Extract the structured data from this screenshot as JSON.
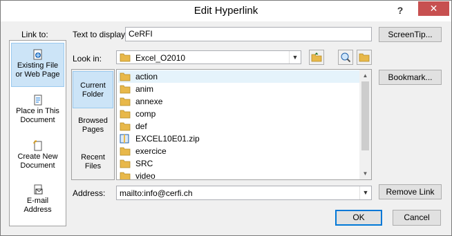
{
  "window": {
    "title": "Edit Hyperlink",
    "help": "?",
    "close": "✕"
  },
  "link_to": {
    "label": "Link to:",
    "items": [
      {
        "l1": "Existing File",
        "l2": "or Web Page",
        "icon": "web-page-icon",
        "selected": true
      },
      {
        "l1": "Place in This",
        "l2": "Document",
        "icon": "document-place-icon",
        "selected": false
      },
      {
        "l1": "Create New",
        "l2": "Document",
        "icon": "new-document-icon",
        "selected": false
      },
      {
        "l1": "E-mail",
        "l2": "Address",
        "icon": "email-icon",
        "selected": false
      }
    ]
  },
  "text_to_display": {
    "label": "Text to display:",
    "value": "CeRFI"
  },
  "screentip": "ScreenTip...",
  "look_in": {
    "label": "Look in:",
    "value": "Excel_O2010"
  },
  "sidebar": {
    "items": [
      {
        "l1": "Current",
        "l2": "Folder",
        "selected": true
      },
      {
        "l1": "Browsed",
        "l2": "Pages",
        "selected": false
      },
      {
        "l1": "Recent",
        "l2": "Files",
        "selected": false
      }
    ]
  },
  "files": [
    {
      "name": "action",
      "type": "folder",
      "selected": true
    },
    {
      "name": "anim",
      "type": "folder",
      "selected": false
    },
    {
      "name": "annexe",
      "type": "folder",
      "selected": false
    },
    {
      "name": "comp",
      "type": "folder",
      "selected": false
    },
    {
      "name": "def",
      "type": "folder",
      "selected": false
    },
    {
      "name": "EXCEL10E01.zip",
      "type": "zip",
      "selected": false
    },
    {
      "name": "exercice",
      "type": "folder",
      "selected": false
    },
    {
      "name": "SRC",
      "type": "folder",
      "selected": false
    },
    {
      "name": "video",
      "type": "folder",
      "selected": false
    }
  ],
  "bookmark": "Bookmark...",
  "address": {
    "label": "Address:",
    "value": "mailto:info@cerfi.ch"
  },
  "remove_link": "Remove Link",
  "ok": "OK",
  "cancel": "Cancel",
  "colors": {
    "accent": "#0078d7",
    "selection": "#cce4f7",
    "folder": "#e8b84a",
    "close": "#c75050"
  }
}
